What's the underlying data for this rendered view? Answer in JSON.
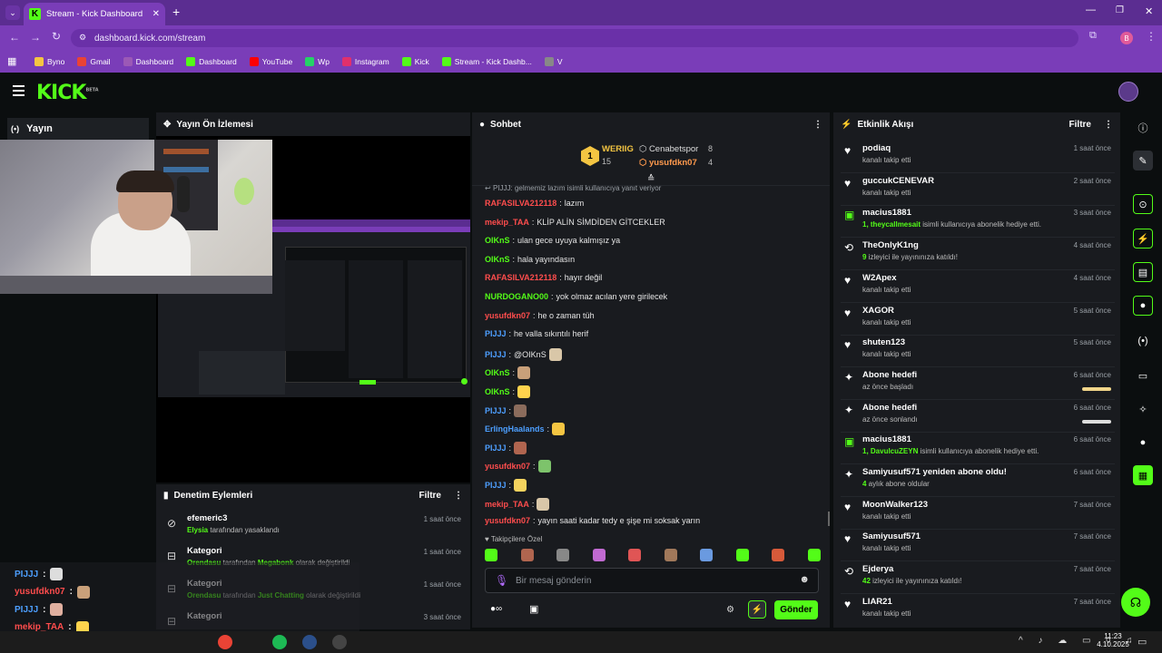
{
  "browser": {
    "tab_title": "Stream - Kick Dashboard",
    "url": "dashboard.kick.com/stream",
    "bookmarks": [
      {
        "label": "Byno",
        "color": "#f4c542"
      },
      {
        "label": "Gmail",
        "color": "#ea4335"
      },
      {
        "label": "Dashboard",
        "color": "#9b59b6"
      },
      {
        "label": "Dashboard",
        "color": "#53fc18"
      },
      {
        "label": "YouTube",
        "color": "#ff0000"
      },
      {
        "label": "Wp",
        "color": "#25d366"
      },
      {
        "label": "Instagram",
        "color": "#e1306c"
      },
      {
        "label": "Kick",
        "color": "#53fc18"
      },
      {
        "label": "Stream - Kick Dashb...",
        "color": "#53fc18"
      },
      {
        "label": "V",
        "color": "#888888"
      }
    ],
    "profile_initial": "B"
  },
  "kick": {
    "logo": "KICK",
    "logo_badge": "BETA",
    "accent": "#53fc18"
  },
  "sidebar": {
    "yayin_label": "Yayın"
  },
  "preview": {
    "title": "Yayın Ön İzlemesi"
  },
  "moderation": {
    "title": "Denetim Eylemleri",
    "filter": "Filtre",
    "items": [
      {
        "icon": "ban-icon",
        "name": "efemeric3",
        "actor": "Elysia",
        "rest": " tarafından yasaklandı",
        "extra": "",
        "extra_rest": "",
        "time": "1 saat önce"
      },
      {
        "icon": "category-icon",
        "name": "Kategori",
        "actor": "Orendasu",
        "rest": " tarafından ",
        "extra": "Megabonk",
        "extra_rest": " olarak değiştirildi",
        "time": "1 saat önce"
      },
      {
        "icon": "category-icon",
        "name": "Kategori",
        "actor": "Orendasu",
        "rest": " tarafından ",
        "extra": "Just Chatting",
        "extra_rest": " olarak değiştirildi",
        "time": "1 saat önce"
      },
      {
        "icon": "category-icon",
        "name": "Kategori",
        "actor": "",
        "rest": "",
        "extra": "",
        "extra_rest": "",
        "time": "3 saat önce"
      }
    ]
  },
  "chat": {
    "title": "Sohbet",
    "leaderboard": [
      {
        "rank": "1",
        "name": "WERIIG",
        "count": "15"
      },
      {
        "name": "Cenabetspor",
        "count": "8"
      },
      {
        "name": "yusufdkn07",
        "count": "4"
      }
    ],
    "reply_note": "PIJJJ: gelmemiz lazım isimli kullanıcıya yanıt veriyor",
    "messages": [
      {
        "user": "RAFASILVA212118",
        "color": "#ff4d4d",
        "text": "lazım"
      },
      {
        "user": "mekip_TAA",
        "color": "#ff4d4d",
        "text": "KLİP ALİN SİMDİDEN GİTCEKLER"
      },
      {
        "user": "OIKnS",
        "color": "#53fc18",
        "text": "ulan gece uyuya kalmışız ya"
      },
      {
        "user": "OIKnS",
        "color": "#53fc18",
        "text": "hala yayındasın"
      },
      {
        "user": "RAFASILVA212118",
        "color": "#ff4d4d",
        "text": "hayır değil"
      },
      {
        "user": "NURDOGANO00",
        "color": "#53fc18",
        "text": "yok olmaz acılan yere girilecek"
      },
      {
        "user": "yusufdkn07",
        "color": "#ff4d4d",
        "text": "he o zaman tüh"
      },
      {
        "user": "PIJJJ",
        "color": "#4d9fff",
        "text": "he valla sıkıntılı herif"
      },
      {
        "user": "PIJJJ",
        "color": "#4d9fff",
        "text": "@OIKnS"
      },
      {
        "user": "OIKnS",
        "color": "#53fc18",
        "text": ""
      },
      {
        "user": "OIKnS",
        "color": "#53fc18",
        "text": ""
      },
      {
        "user": "PIJJJ",
        "color": "#4d9fff",
        "text": ""
      },
      {
        "user": "ErlingHaalands",
        "color": "#4d9fff",
        "text": ""
      },
      {
        "user": "PIJJJ",
        "color": "#4d9fff",
        "text": ""
      },
      {
        "user": "yusufdkn07",
        "color": "#ff4d4d",
        "text": ""
      },
      {
        "user": "PIJJJ",
        "color": "#4d9fff",
        "text": ""
      },
      {
        "user": "mekip_TAA",
        "color": "#ff4d4d",
        "text": ""
      },
      {
        "user": "yusufdkn07",
        "color": "#ff4d4d",
        "text": "yayın saati kadar tedy e şişe mi soksak yarın"
      }
    ],
    "emote_tab": "Takipçilere Özel",
    "input_placeholder": "Bir mesaj gönderin",
    "send_label": "Gönder"
  },
  "activity": {
    "title": "Etkinlik Akışı",
    "filter": "Filtre",
    "items": [
      {
        "icon": "heart-icon",
        "name": "podiaq",
        "sub_hl": "",
        "sub": "kanalı takip etti",
        "time": "1 saat önce"
      },
      {
        "icon": "heart-icon",
        "name": "guccukCENEVAR",
        "sub_hl": "",
        "sub": "kanalı takip etti",
        "time": "2 saat önce"
      },
      {
        "icon": "gift-icon",
        "name": "macius1881",
        "sub_hl": "1, theycallmesait",
        "sub": " isimli kullanıcıya abonelik hediye etti.",
        "time": "3 saat önce"
      },
      {
        "icon": "raid-icon",
        "name": "TheOnlyK1ng",
        "sub_hl": "9",
        "sub": " izleyici ile yayınınıza katıldı!",
        "time": "4 saat önce"
      },
      {
        "icon": "heart-icon",
        "name": "W2Apex",
        "sub_hl": "",
        "sub": "kanalı takip etti",
        "time": "4 saat önce"
      },
      {
        "icon": "heart-icon",
        "name": "XAGOR",
        "sub_hl": "",
        "sub": "kanalı takip etti",
        "time": "5 saat önce"
      },
      {
        "icon": "heart-icon",
        "name": "shuten123",
        "sub_hl": "",
        "sub": "kanalı takip etti",
        "time": "5 saat önce"
      },
      {
        "icon": "sparkle-icon",
        "name": "Abone hedefi",
        "sub_hl": "",
        "sub": "az önce başladı",
        "time": "6 saat önce"
      },
      {
        "icon": "sparkle-icon",
        "name": "Abone hedefi",
        "sub_hl": "",
        "sub": "az önce sonlandı",
        "time": "6 saat önce"
      },
      {
        "icon": "gift-icon",
        "name": "macius1881",
        "sub_hl": "1, DavulcuZEYN",
        "sub": " isimli kullanıcıya abonelik hediye etti.",
        "time": "6 saat önce"
      },
      {
        "icon": "sparkle-icon",
        "name": "Samiyusuf571 yeniden abone oldu!",
        "sub_hl": "4",
        "sub": " aylık abone oldular",
        "time": "6 saat önce"
      },
      {
        "icon": "heart-icon",
        "name": "MoonWalker123",
        "sub_hl": "",
        "sub": "kanalı takip etti",
        "time": "7 saat önce"
      },
      {
        "icon": "heart-icon",
        "name": "Samiyusuf571",
        "sub_hl": "",
        "sub": "kanalı takip etti",
        "time": "7 saat önce"
      },
      {
        "icon": "raid-icon",
        "name": "Ejderya",
        "sub_hl": "42",
        "sub": " izleyici ile yayınınıza katıldı!",
        "time": "7 saat önce"
      },
      {
        "icon": "heart-icon",
        "name": "LIAR21",
        "sub_hl": "",
        "sub": "kanalı takip etti",
        "time": "7 saat önce"
      }
    ]
  },
  "overlay_chat": [
    {
      "user": "PIJJJ",
      "color": "#4d9fff",
      "text": ""
    },
    {
      "user": "yusufdkn07",
      "color": "#ff4d4d",
      "text": ""
    },
    {
      "user": "PIJJJ",
      "color": "#4d9fff",
      "text": ""
    },
    {
      "user": "mekip_TAA",
      "color": "#ff4d4d",
      "text": ""
    },
    {
      "user": "yusufdkn07",
      "color": "#ff4d4d",
      "text": "yayın saati kadar tedy e şişe mi soksak yarın"
    }
  ],
  "taskbar": {
    "time": "11:23",
    "date": "4.10.2025"
  }
}
